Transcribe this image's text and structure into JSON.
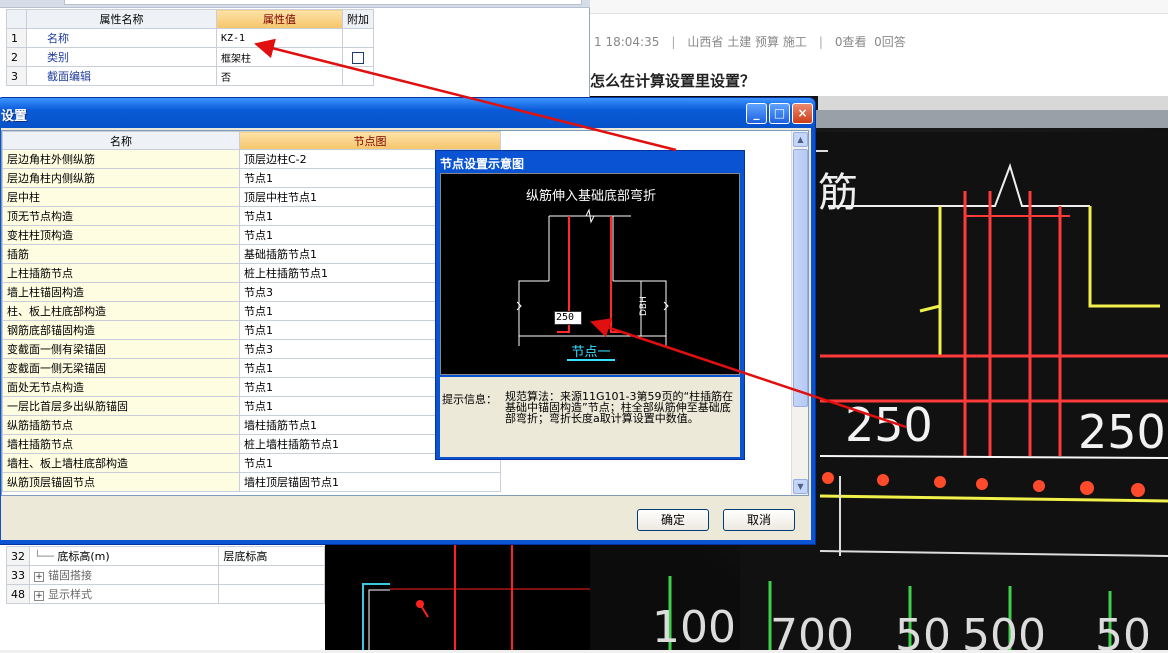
{
  "property_grid": {
    "headers": [
      "属性名称",
      "属性值",
      "附加"
    ],
    "rows": [
      {
        "num": "1",
        "name": "名称",
        "value": "KZ-1",
        "has_checkbox": false
      },
      {
        "num": "2",
        "name": "类别",
        "value": "框架柱",
        "has_checkbox": true
      },
      {
        "num": "3",
        "name": "截面编辑",
        "value": "否",
        "has_checkbox": false
      }
    ],
    "bottom_rows": [
      {
        "num": "32",
        "name": "底标高(m)",
        "value": "层底标高",
        "expander": ""
      },
      {
        "num": "33",
        "name": "锚固搭接",
        "value": "",
        "expander": "+"
      },
      {
        "num": "48",
        "name": "显示样式",
        "value": "",
        "expander": "+"
      }
    ]
  },
  "forum": {
    "time": "1 18:04:35",
    "tags": "山西省  土建  预算  施工",
    "views": "0查看",
    "answers": "0回答",
    "title": "怎么在计算设置里设置？"
  },
  "settings_dialog": {
    "title": "设置",
    "window_buttons": {
      "minimize": "_",
      "maximize": "□",
      "close": "×"
    },
    "headers": {
      "name": "名称",
      "node": "节点图"
    },
    "rows": [
      {
        "name": "层边角柱外侧纵筋",
        "node": "顶层边柱C-2"
      },
      {
        "name": "层边角柱内侧纵筋",
        "node": "节点1"
      },
      {
        "name": "层中柱",
        "node": "顶层中柱节点1"
      },
      {
        "name": "顶无节点构造",
        "node": "节点1"
      },
      {
        "name": "变柱柱顶构造",
        "node": "节点1"
      },
      {
        "name": "插筋",
        "node": "基础插筋节点1"
      },
      {
        "name": "上柱插筋节点",
        "node": "桩上柱插筋节点1"
      },
      {
        "name": "墙上柱锚固构造",
        "node": "节点3"
      },
      {
        "name": "柱、板上柱底部构造",
        "node": "节点1"
      },
      {
        "name": "钢筋底部锚固构造",
        "node": "节点1"
      },
      {
        "name": "变截面一侧有梁锚固",
        "node": "节点3"
      },
      {
        "name": "变截面一侧无梁锚固",
        "node": "节点1"
      },
      {
        "name": "面处无节点构造",
        "node": "节点1"
      },
      {
        "name": "一层比首层多出纵筋锚固",
        "node": "节点1"
      },
      {
        "name": "纵筋插筋节点",
        "node": "墙柱插筋节点1"
      },
      {
        "name": "墙柱插筋节点",
        "node": "桩上墙柱插筋节点1"
      },
      {
        "name": "墙柱、板上墙柱底部构造",
        "node": "节点1"
      },
      {
        "name": "纵筋顶层锚固节点",
        "node": "墙柱顶层锚固节点1"
      }
    ],
    "ok_label": "确定",
    "cancel_label": "取消"
  },
  "node_dialog": {
    "title": "节点设置示意图",
    "diagram_heading": "纵筋伸入基础底部弯折",
    "dim_label": "DBH",
    "input_value": "250",
    "node_name": "节点一",
    "info_label": "提示信息：",
    "info_text": "规范算法：来源11G101-3第59页的“柱插筋在基础中锚固构造”节点；柱全部纵筋伸至基础底部弯折；弯折长度a取计算设置中数值。"
  },
  "photo": {
    "label_rebar": "筋",
    "dims_mid": [
      "250",
      "250"
    ],
    "dims_bottom": [
      "100",
      "700",
      "50",
      "500",
      "50"
    ]
  },
  "colors": {
    "titlebar": "#0a54d4",
    "header_orange": "#f5c56a",
    "annotation_red": "#e01010"
  }
}
